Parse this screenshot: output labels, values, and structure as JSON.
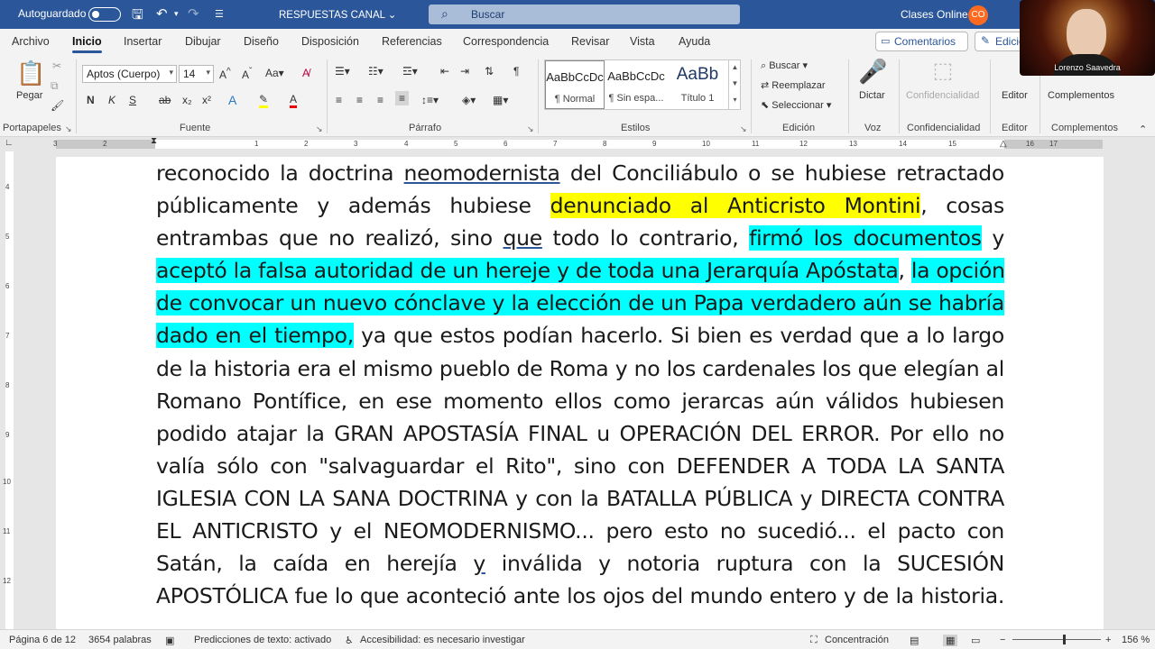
{
  "titlebar": {
    "autosave_label": "Autoguardado",
    "doc_title": "RESPUESTAS CANAL",
    "search_placeholder": "Buscar",
    "account_name": "Clases Online",
    "account_initials": "CO"
  },
  "tabs": [
    "Archivo",
    "Inicio",
    "Insertar",
    "Dibujar",
    "Diseño",
    "Disposición",
    "Referencias",
    "Correspondencia",
    "Revisar",
    "Vista",
    "Ayuda"
  ],
  "active_tab": "Inicio",
  "header_buttons": {
    "comments": "Comentarios",
    "edit": "Edición"
  },
  "ribbon": {
    "clipboard": {
      "paste": "Pegar",
      "group": "Portapapeles"
    },
    "font": {
      "family": "Aptos (Cuerpo)",
      "size": "14",
      "group": "Fuente"
    },
    "paragraph": {
      "group": "Párrafo"
    },
    "styles": {
      "group": "Estilos",
      "items": [
        {
          "preview": "AaBbCcDc",
          "name": "¶ Normal"
        },
        {
          "preview": "AaBbCcDc",
          "name": "¶ Sin espa..."
        },
        {
          "preview": "AaBb",
          "name": "Título 1"
        }
      ]
    },
    "editing": {
      "find": "Buscar",
      "replace": "Reemplazar",
      "select": "Seleccionar",
      "group": "Edición"
    },
    "voice": {
      "dictate": "Dictar",
      "group": "Voz"
    },
    "sensitivity": {
      "label": "Confidencialidad",
      "group": "Confidencialidad"
    },
    "editor": {
      "label": "Editor",
      "group": "Editor"
    },
    "addins": {
      "label": "Complementos",
      "group": "Complementos"
    }
  },
  "ruler_numbers": [
    "3",
    "2",
    "1",
    "1",
    "2",
    "3",
    "4",
    "5",
    "6",
    "7",
    "8",
    "9",
    "10",
    "11",
    "12",
    "13",
    "14",
    "15",
    "16",
    "17"
  ],
  "vruler_numbers": [
    "4",
    "5",
    "6",
    "7",
    "8",
    "9",
    "10",
    "11",
    "12"
  ],
  "document": {
    "lines": [
      [
        {
          "t": "reconocido la doctrina "
        },
        {
          "t": "neomodernista",
          "u": true
        },
        {
          "t": " del Conciliábulo o se hubiese retractado"
        }
      ],
      [
        {
          "t": "públicamente y además hubiese "
        },
        {
          "t": "denunciado al Anticristo Montini",
          "h": "y"
        },
        {
          "t": ", cosas"
        }
      ],
      [
        {
          "t": "entrambas que no realizó, sino "
        },
        {
          "t": "que",
          "u": true
        },
        {
          "t": " todo lo contrario, "
        },
        {
          "t": "firmó los documentos",
          "h": "c"
        },
        {
          "t": " y"
        }
      ],
      [
        {
          "t": "aceptó la falsa autoridad de un hereje y de toda una Jerarquía Apóstata",
          "h": "c"
        },
        {
          "t": ", "
        },
        {
          "t": "la opción",
          "h": "c"
        }
      ],
      [
        {
          "t": "de convocar un nuevo cónclave y la elección de un Papa verdadero aún se habría",
          "h": "c"
        }
      ],
      [
        {
          "t": "dado en el tiempo,",
          "h": "c"
        },
        {
          "t": " ya que estos podían hacerlo. Si bien es verdad que a lo largo"
        }
      ],
      [
        {
          "t": "de la historia era el mismo pueblo de Roma y no los cardenales los que elegían al"
        }
      ],
      [
        {
          "t": "Romano Pontífice, en ese momento ellos como jerarcas aún válidos hubiesen"
        }
      ],
      [
        {
          "t": "podido atajar la GRAN APOSTASÍA FINAL u OPERACIÓN DEL ERROR. Por ello no"
        }
      ],
      [
        {
          "t": "valía sólo con \"salvaguardar el Rito\", sino con DEFENDER A TODA LA SANTA"
        }
      ],
      [
        {
          "t": "IGLESIA CON LA SANA DOCTRINA y con la BATALLA PÚBLICA y DIRECTA CONTRA"
        }
      ],
      [
        {
          "t": "EL ANTICRISTO y el NEOMODERNISMO... pero esto no sucedió... el pacto con"
        }
      ],
      [
        {
          "t": "Satán, la caída en herejía "
        },
        {
          "t": "y",
          "u": true
        },
        {
          "t": " inválida y notoria ruptura con la SUCESIÓN"
        }
      ],
      [
        {
          "t": "APOSTÓLICA fue lo que aconteció ante los ojos del mundo entero y de la historia."
        }
      ]
    ]
  },
  "statusbar": {
    "page": "Página 6 de 12",
    "words": "3654 palabras",
    "predictions": "Predicciones de texto: activado",
    "accessibility": "Accesibilidad: es necesario investigar",
    "focus": "Concentración",
    "zoom": "156 %"
  },
  "webcam": {
    "name": "Lorenzo Saavedra"
  },
  "colors": {
    "title_bar": "#2b579a",
    "highlight_yellow": "#ffff00",
    "highlight_cyan": "#00ffff",
    "account_badge": "#ff6a21"
  }
}
